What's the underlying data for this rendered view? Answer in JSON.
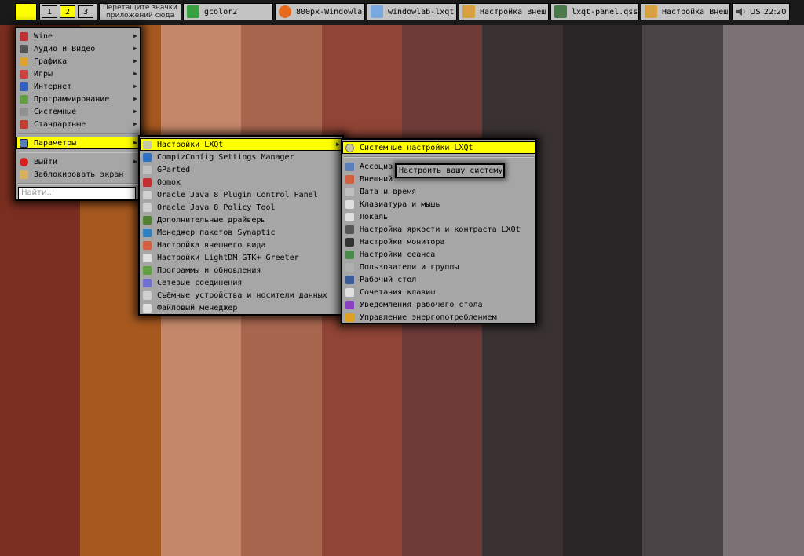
{
  "wallpaper": {
    "colors": [
      "#7a2e20",
      "#a6581f",
      "#c4876a",
      "#b47560",
      "#8f4435",
      "#873d35",
      "#6a3c38",
      "#3a3232",
      "#252323",
      "#4a4447",
      "#7a7275",
      "#8e8e8e",
      "#a9a9a9"
    ]
  },
  "panel": {
    "pager": [
      "1",
      "2",
      "3"
    ],
    "active_desktop": "2",
    "quicklaunch": {
      "line1": "Перетащите значки",
      "line2": "приложений сюда"
    },
    "tasks": [
      {
        "label": "gcolor2",
        "icon": "gcolor-icon"
      },
      {
        "label": "800px-Windowla",
        "icon": "firefox-icon"
      },
      {
        "label": "windowlab-lxqt",
        "icon": "folder-icon"
      },
      {
        "label": "Настройка Внеш",
        "icon": "appearance-icon"
      },
      {
        "label": "lxqt-panel.qss",
        "icon": "text-editor-icon"
      },
      {
        "label": "Настройка Внеш",
        "icon": "appearance-icon"
      }
    ],
    "tray": {
      "keyboard_layout": "US",
      "clock": "22:20",
      "volume_icon": "speaker-icon"
    }
  },
  "main_menu": {
    "items": [
      {
        "label": "Wine",
        "submenu": true
      },
      {
        "label": "Аудио и Видео",
        "submenu": true
      },
      {
        "label": "Графика",
        "submenu": true
      },
      {
        "label": "Игры",
        "submenu": true
      },
      {
        "label": "Интернет",
        "submenu": true
      },
      {
        "label": "Программирование",
        "submenu": true
      },
      {
        "label": "Системные",
        "submenu": true
      },
      {
        "label": "Стандартные",
        "submenu": true
      }
    ],
    "parameters": "Параметры",
    "logout": "Выйти",
    "lock": "Заблокировать экран",
    "search_placeholder": "Найти..."
  },
  "params_menu": {
    "items": [
      {
        "label": "Настройки LXQt",
        "submenu": true
      },
      {
        "label": "CompizConfig Settings Manager"
      },
      {
        "label": "GParted"
      },
      {
        "label": "Oomox"
      },
      {
        "label": "Oracle Java 8 Plugin Control Panel"
      },
      {
        "label": "Oracle Java 8 Policy Tool"
      },
      {
        "label": "Дополнительные драйверы"
      },
      {
        "label": "Менеджер пакетов Synaptic"
      },
      {
        "label": "Настройка внешнего вида"
      },
      {
        "label": "Настройки LightDM GTK+ Greeter"
      },
      {
        "label": "Программы и обновления"
      },
      {
        "label": "Сетевые соединения"
      },
      {
        "label": "Съёмные устройства и носители данных"
      },
      {
        "label": "Файловый менеджер"
      }
    ]
  },
  "lxqt_menu": {
    "header": "Системные настройки LXQt",
    "items": [
      {
        "label": "Ассоциа"
      },
      {
        "label": "Внешний"
      },
      {
        "label": "Дата и время"
      },
      {
        "label": "Клавиатура и мышь"
      },
      {
        "label": "Локаль"
      },
      {
        "label": "Настройка яркости и контраста LXQt"
      },
      {
        "label": "Настройки монитора"
      },
      {
        "label": "Настройки сеанса"
      },
      {
        "label": "Пользователи и группы"
      },
      {
        "label": "Рабочий стол"
      },
      {
        "label": "Сочетания клавиш"
      },
      {
        "label": "Уведомления рабочего стола"
      },
      {
        "label": "Управление энергопотреблением"
      }
    ]
  },
  "tooltip": "Настроить вашу систему"
}
